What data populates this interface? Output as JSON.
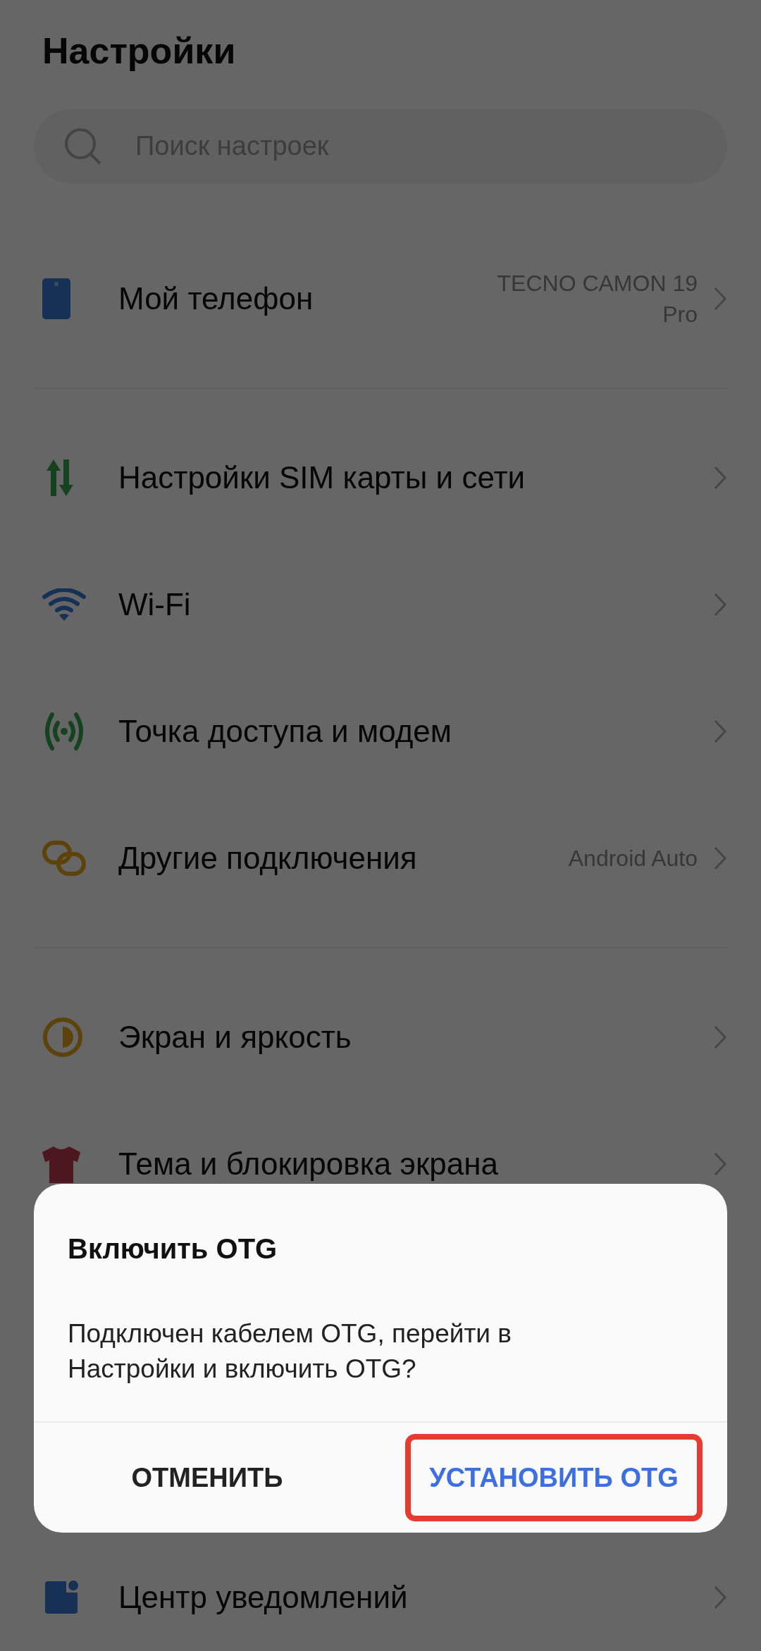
{
  "page": {
    "title": "Настройки"
  },
  "search": {
    "placeholder": "Поиск настроек"
  },
  "sections": [
    {
      "items": [
        {
          "label": "Мой телефон",
          "value": "TECNO CAMON 19 Pro"
        }
      ]
    },
    {
      "items": [
        {
          "label": "Настройки SIM карты и сети"
        },
        {
          "label": "Wi-Fi"
        },
        {
          "label": "Точка доступа и модем"
        },
        {
          "label": "Другие подключения",
          "value": "Android Auto"
        }
      ]
    },
    {
      "items": [
        {
          "label": "Экран и яркость"
        },
        {
          "label": "Тема и блокировка экрана"
        }
      ]
    },
    {
      "items": [
        {
          "label": "Центр уведомлений"
        }
      ]
    }
  ],
  "dialog": {
    "title": "Включить OTG",
    "message": "Подключен кабелем OTG, перейти в Настройки и включить OTG?",
    "buttons": [
      {
        "label": "ОТМЕНИТЬ",
        "kind": "cancel",
        "highlighted": false
      },
      {
        "label": "УСТАНОВИТЬ OTG",
        "kind": "confirm",
        "highlighted": true
      }
    ]
  }
}
